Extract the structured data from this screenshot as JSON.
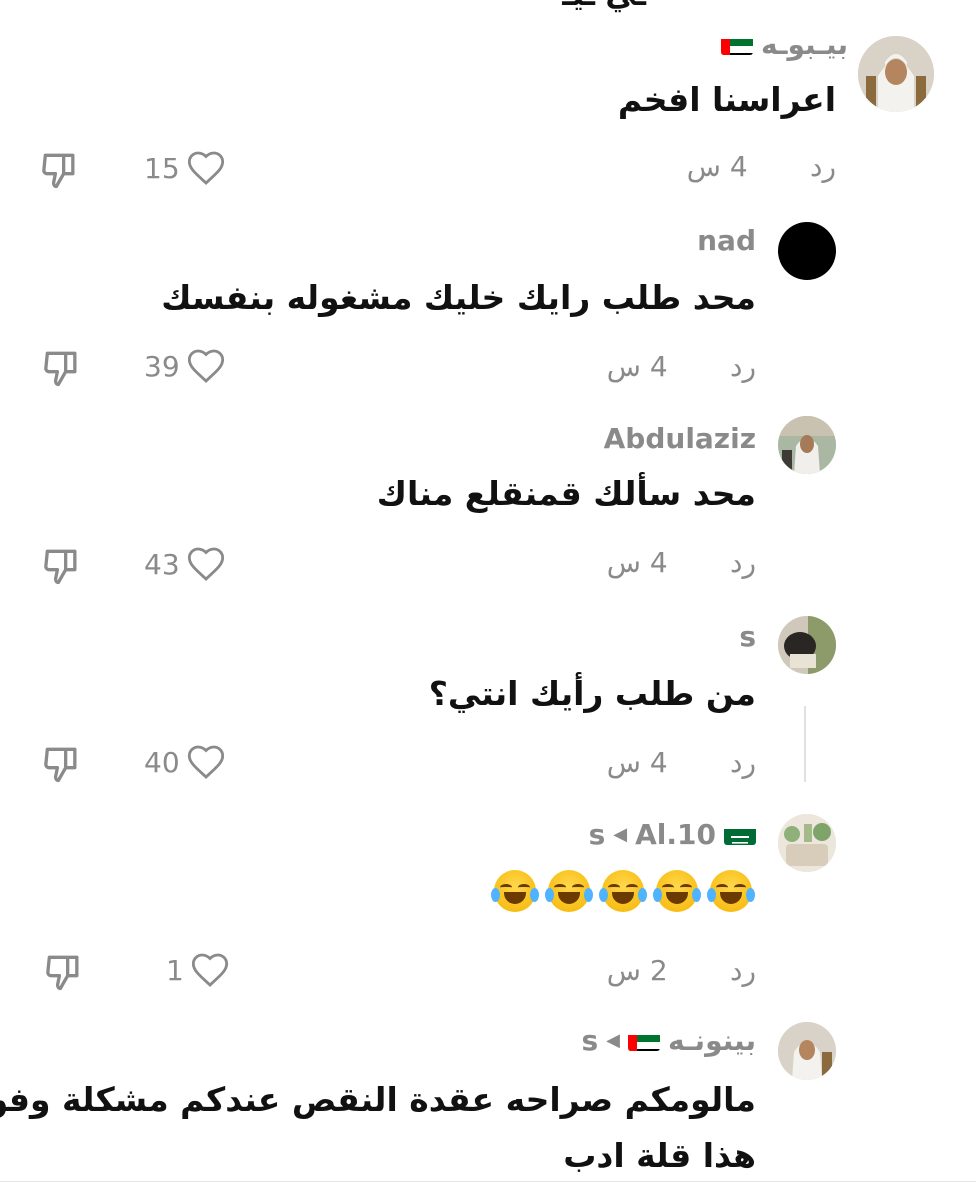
{
  "top_fragment": "ـي ـيـ",
  "comments": [
    {
      "username": "بيـبوـه",
      "reply_to": "",
      "flag": "uae",
      "text_lines": [
        "اعراسنا افخم"
      ],
      "time": "4 س",
      "reply_label": "رد",
      "likes": "15"
    },
    {
      "username": "nad",
      "reply_to": "",
      "flag": "",
      "text_lines": [
        "محد طلب رايك خليك مشغوله بنفسك"
      ],
      "time": "4 س",
      "reply_label": "رد",
      "likes": "39"
    },
    {
      "username": "Abdulaziz",
      "reply_to": "",
      "flag": "",
      "text_lines": [
        "محد سألك قمنقلع مناك"
      ],
      "time": "4 س",
      "reply_label": "رد",
      "likes": "43"
    },
    {
      "username": "s",
      "reply_to": "",
      "flag": "",
      "text_lines": [
        "من طلب رأيك انتي؟"
      ],
      "time": "4 س",
      "reply_label": "رد",
      "likes": "40"
    },
    {
      "username": "Al.10",
      "reply_to": "s",
      "flag": "saudi",
      "text_lines": [
        "😂😂😂😂😂"
      ],
      "time": "2 س",
      "reply_label": "رد",
      "likes": "1"
    },
    {
      "username": "بينونـه",
      "reply_to": "s",
      "flag": "uae",
      "text_lines": [
        "مالومكم صراحه عقدة النقص عندكم مشكلة وفوق",
        "هذا قلة ادب"
      ],
      "time": "",
      "reply_label": "",
      "likes": ""
    }
  ],
  "colors": {
    "muted": "#8a8a8a",
    "text": "#111111"
  }
}
